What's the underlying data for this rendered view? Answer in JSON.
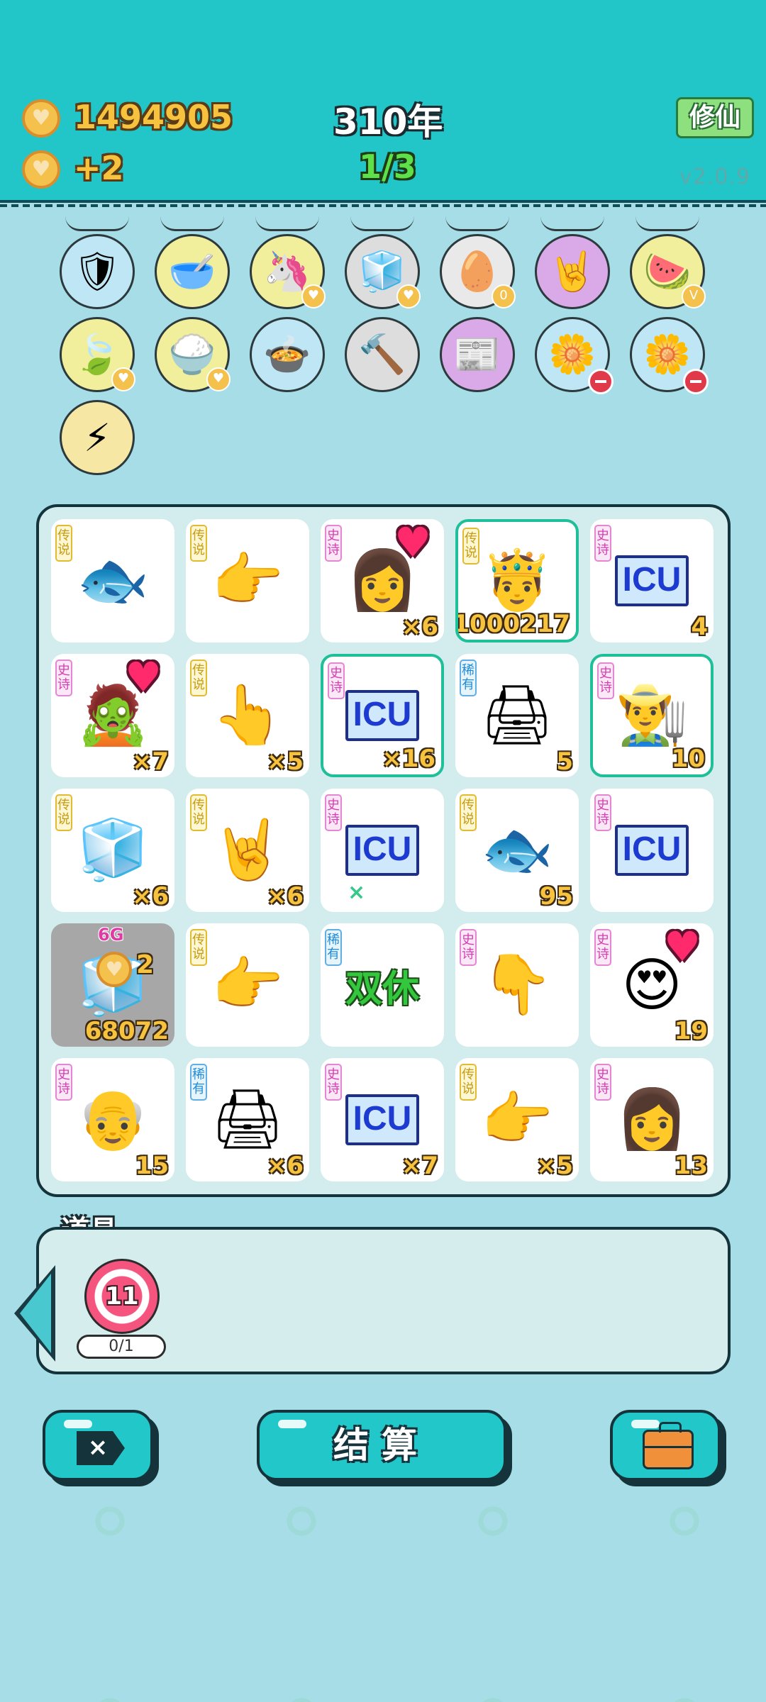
{
  "hud": {
    "coins": "1494905",
    "income": "+2",
    "year": "310年",
    "progress": "1/3",
    "mode_button": "修仙",
    "version": "v2.0.9"
  },
  "relics": [
    {
      "name": "shield-icon",
      "glyph": "🛡",
      "color": "#bfe6f5",
      "badge": ""
    },
    {
      "name": "pet-bowl-icon",
      "glyph": "🥣",
      "color": "#f1ee9c",
      "badge": ""
    },
    {
      "name": "unicorn-icon",
      "glyph": "🦄",
      "color": "#f1ee9c",
      "badge": "coin"
    },
    {
      "name": "sugar-cubes-icon",
      "glyph": "🧊",
      "color": "#dddddd",
      "badge": "coin"
    },
    {
      "name": "egg-carton-icon",
      "glyph": "🥚",
      "color": "#e9e9e9",
      "badge": "0"
    },
    {
      "name": "rock-hand-icon",
      "glyph": "🤘",
      "color": "#d9a9e8",
      "badge": ""
    },
    {
      "name": "fruit-bowl-icon",
      "glyph": "🍉",
      "color": "#f1ee9c",
      "badge": "V"
    },
    {
      "name": "leaf-icon",
      "glyph": "🍃",
      "color": "#f1ee9c",
      "badge": "coin"
    },
    {
      "name": "rice-bowl-icon",
      "glyph": "🍚",
      "color": "#f1ee9c",
      "badge": "coin"
    },
    {
      "name": "pot-icon",
      "glyph": "🍲",
      "color": "#bfe6f5",
      "badge": ""
    },
    {
      "name": "hammer-icon",
      "glyph": "🔨",
      "color": "#dddddd",
      "badge": ""
    },
    {
      "name": "time-magazine-icon",
      "glyph": "📰",
      "color": "#d9a9e8",
      "badge": ""
    },
    {
      "name": "flower-pot-icon",
      "glyph": "🌼",
      "color": "#bfe6f5",
      "badge": "minus"
    },
    {
      "name": "flower-pot-icon",
      "glyph": "🌼",
      "color": "#bfe6f5",
      "badge": "minus"
    },
    {
      "name": "lightning-icon",
      "glyph": "⚡",
      "color": "#f6e7a4",
      "badge": ""
    }
  ],
  "board": {
    "tiles": [
      {
        "icon": "koi-fish-icon",
        "glyph": "🐟",
        "rarity": "传说",
        "rclass": "leg",
        "value": "",
        "hl": false
      },
      {
        "icon": "pointing-hand-icon",
        "glyph": "👉",
        "rarity": "传说",
        "rclass": "leg",
        "value": "",
        "hl": false
      },
      {
        "icon": "girl-face-icon",
        "glyph": "👩",
        "rarity": "史诗",
        "rclass": "epic",
        "value": "×6",
        "hl": false,
        "heart": true
      },
      {
        "icon": "king-face-icon",
        "glyph": "🤴",
        "rarity": "传说",
        "rclass": "leg",
        "value": "1000217",
        "hl": true
      },
      {
        "icon": "icu-icon",
        "glyph": "ICU",
        "rarity": "史诗",
        "rclass": "epic",
        "value": "4",
        "hl": false
      },
      {
        "icon": "zombie-face-icon",
        "glyph": "🧟",
        "rarity": "史诗",
        "rclass": "epic",
        "value": "×7",
        "hl": false,
        "heart": true
      },
      {
        "icon": "pointing-hand-icon",
        "glyph": "👆",
        "rarity": "传说",
        "rclass": "leg",
        "value": "×5",
        "hl": false
      },
      {
        "icon": "icu-icon",
        "glyph": "ICU",
        "rarity": "史诗",
        "rclass": "epic",
        "value": "×16",
        "hl": true
      },
      {
        "icon": "printer-icon",
        "glyph": "🖨",
        "rarity": "稀有",
        "rclass": "rare",
        "value": "5",
        "hl": false
      },
      {
        "icon": "farmer-face-icon",
        "glyph": "👨‍🌾",
        "rarity": "史诗",
        "rclass": "epic",
        "value": "10",
        "hl": true
      },
      {
        "icon": "fridge-icon",
        "glyph": "🧊",
        "rarity": "传说",
        "rclass": "leg",
        "value": "×6",
        "hl": false
      },
      {
        "icon": "rock-hand-icon",
        "glyph": "🤘",
        "rarity": "传说",
        "rclass": "leg",
        "value": "×6",
        "hl": false
      },
      {
        "icon": "icu-icon",
        "glyph": "ICU",
        "rarity": "史诗",
        "rclass": "epic",
        "value": "",
        "hl": false,
        "greenx": "×"
      },
      {
        "icon": "koi-fish-icon",
        "glyph": "🐟",
        "rarity": "传说",
        "rclass": "leg",
        "value": "95",
        "hl": false
      },
      {
        "icon": "icu-icon",
        "glyph": "ICU",
        "rarity": "史诗",
        "rclass": "epic",
        "value": "",
        "hl": false
      },
      {
        "icon": "fridge-icon",
        "glyph": "🧊",
        "rarity": "",
        "rclass": "",
        "value": "68072",
        "hl": false,
        "grey": true,
        "sixg": "6G",
        "small": "2"
      },
      {
        "icon": "pointing-hand-icon",
        "glyph": "👉",
        "rarity": "传说",
        "rclass": "leg",
        "value": "",
        "hl": false
      },
      {
        "icon": "double-rest-icon",
        "glyph": "双休",
        "rarity": "稀有",
        "rclass": "rare",
        "value": "",
        "hl": false
      },
      {
        "icon": "grey-hand-icon",
        "glyph": "👇",
        "rarity": "史诗",
        "rclass": "epic",
        "value": "",
        "hl": false
      },
      {
        "icon": "heart-eyes-face-icon",
        "glyph": "😍",
        "rarity": "史诗",
        "rclass": "epic",
        "value": "19",
        "hl": false,
        "heart": true
      },
      {
        "icon": "farmer-face-icon",
        "glyph": "👴",
        "rarity": "史诗",
        "rclass": "epic",
        "value": "15",
        "hl": false
      },
      {
        "icon": "printer-icon",
        "glyph": "🖨",
        "rarity": "稀有",
        "rclass": "rare",
        "value": "×6",
        "hl": false
      },
      {
        "icon": "icu-icon",
        "glyph": "ICU",
        "rarity": "史诗",
        "rclass": "epic",
        "value": "×7",
        "hl": false
      },
      {
        "icon": "pointing-hand-icon",
        "glyph": "👉",
        "rarity": "传说",
        "rclass": "leg",
        "value": "×5",
        "hl": false
      },
      {
        "icon": "ghost-girl-icon",
        "glyph": "👩",
        "rarity": "史诗",
        "rclass": "epic",
        "value": "13",
        "hl": false
      }
    ]
  },
  "props": {
    "title": "道具",
    "item_value": "11",
    "uses": "0/1"
  },
  "buttons": {
    "exit_glyph": "×",
    "settle": "结算"
  }
}
